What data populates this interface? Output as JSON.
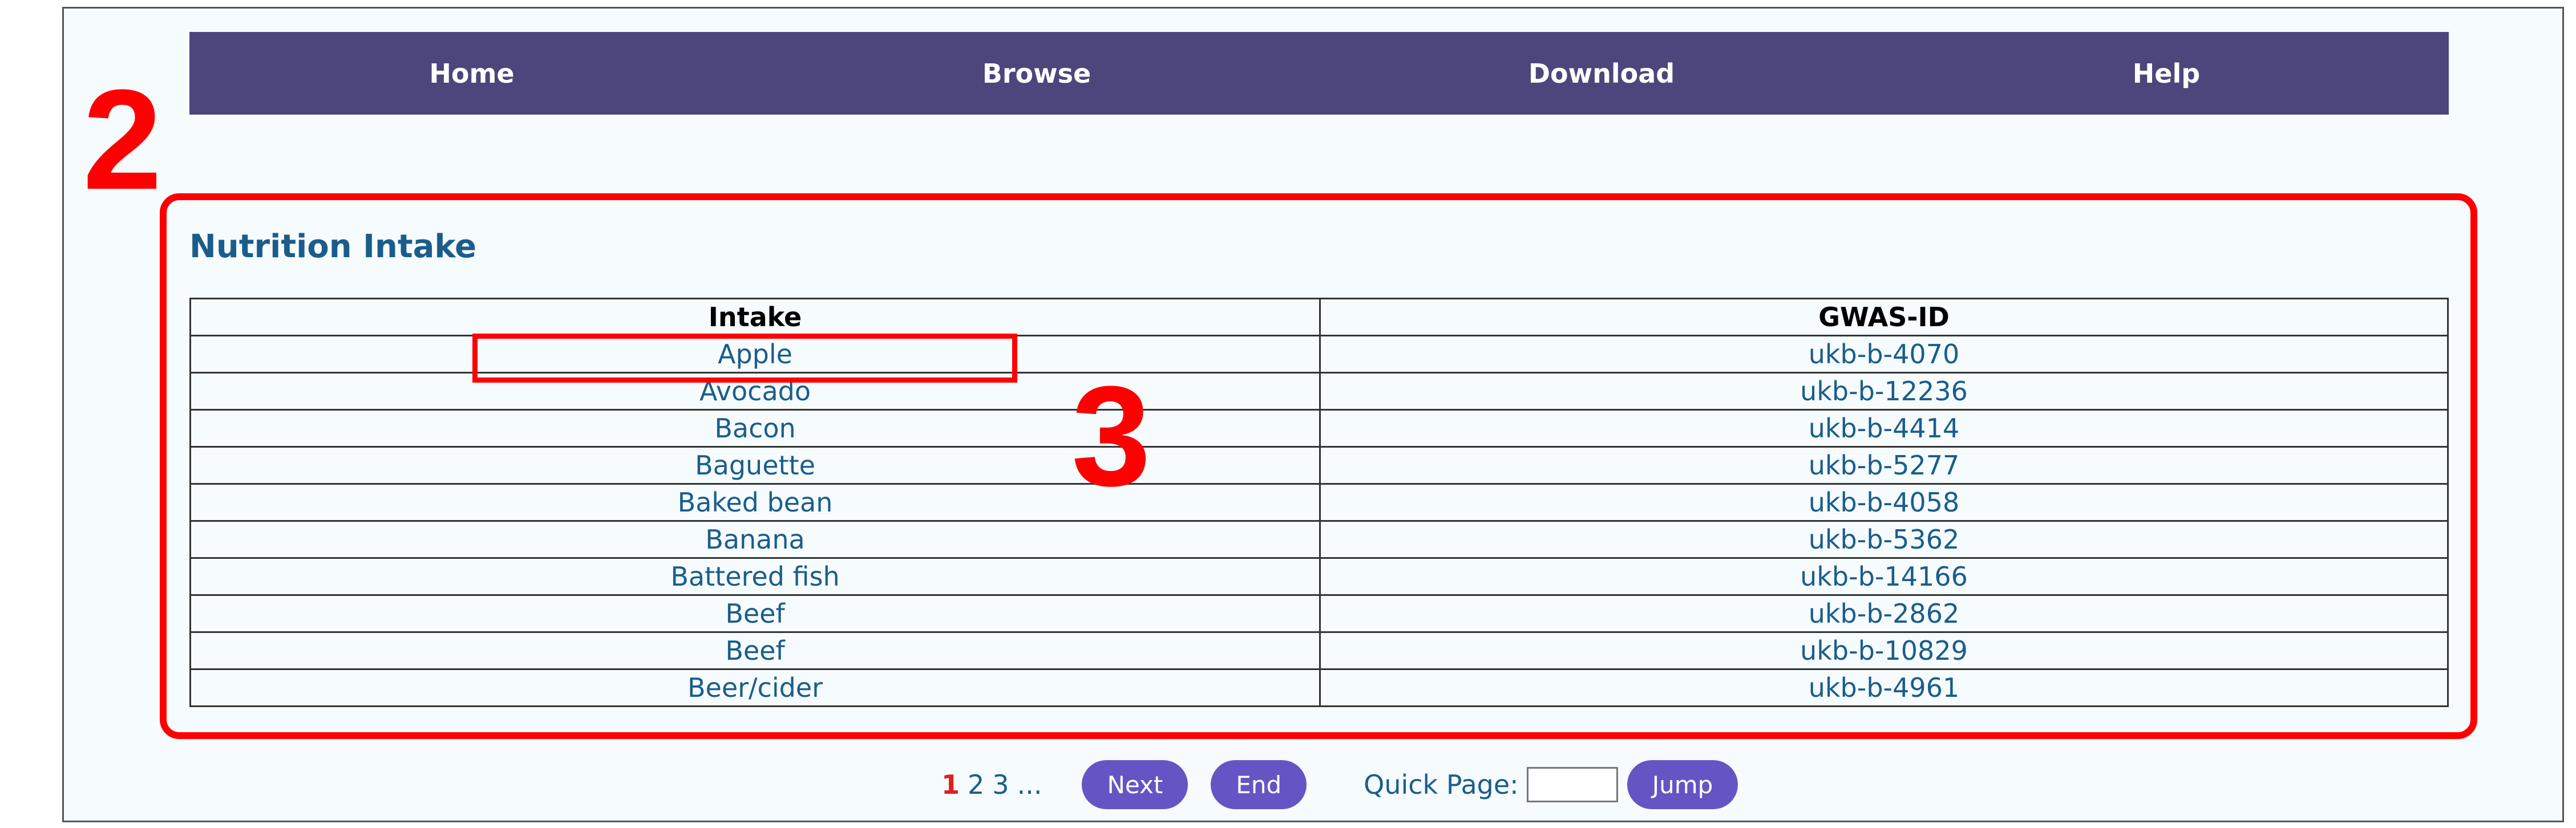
{
  "nav": {
    "items": [
      {
        "label": "Home"
      },
      {
        "label": "Browse"
      },
      {
        "label": "Download"
      },
      {
        "label": "Help"
      }
    ]
  },
  "annotations": {
    "label_outer": "2",
    "label_inner": "3"
  },
  "section": {
    "title": "Nutrition Intake"
  },
  "table": {
    "headers": [
      "Intake",
      "GWAS-ID"
    ],
    "rows": [
      {
        "intake": "Apple",
        "gwas_id": "ukb-b-4070"
      },
      {
        "intake": "Avocado",
        "gwas_id": "ukb-b-12236"
      },
      {
        "intake": "Bacon",
        "gwas_id": "ukb-b-4414"
      },
      {
        "intake": "Baguette",
        "gwas_id": "ukb-b-5277"
      },
      {
        "intake": "Baked bean",
        "gwas_id": "ukb-b-4058"
      },
      {
        "intake": "Banana",
        "gwas_id": "ukb-b-5362"
      },
      {
        "intake": "Battered fish",
        "gwas_id": "ukb-b-14166"
      },
      {
        "intake": "Beef",
        "gwas_id": "ukb-b-2862"
      },
      {
        "intake": "Beef",
        "gwas_id": "ukb-b-10829"
      },
      {
        "intake": "Beer/cider",
        "gwas_id": "ukb-b-4961"
      }
    ]
  },
  "pagination": {
    "pages": [
      "1",
      "2",
      "3"
    ],
    "ellipsis": "...",
    "current_page": "1",
    "next_label": "Next",
    "end_label": "End",
    "quick_page_label": "Quick Page:",
    "quick_page_value": "",
    "jump_label": "Jump"
  },
  "colors": {
    "nav_background": "#4c467c",
    "link": "#1a5d8c",
    "annotation": "#ff0000",
    "button": "#6455c4",
    "current_page": "#e02020"
  }
}
